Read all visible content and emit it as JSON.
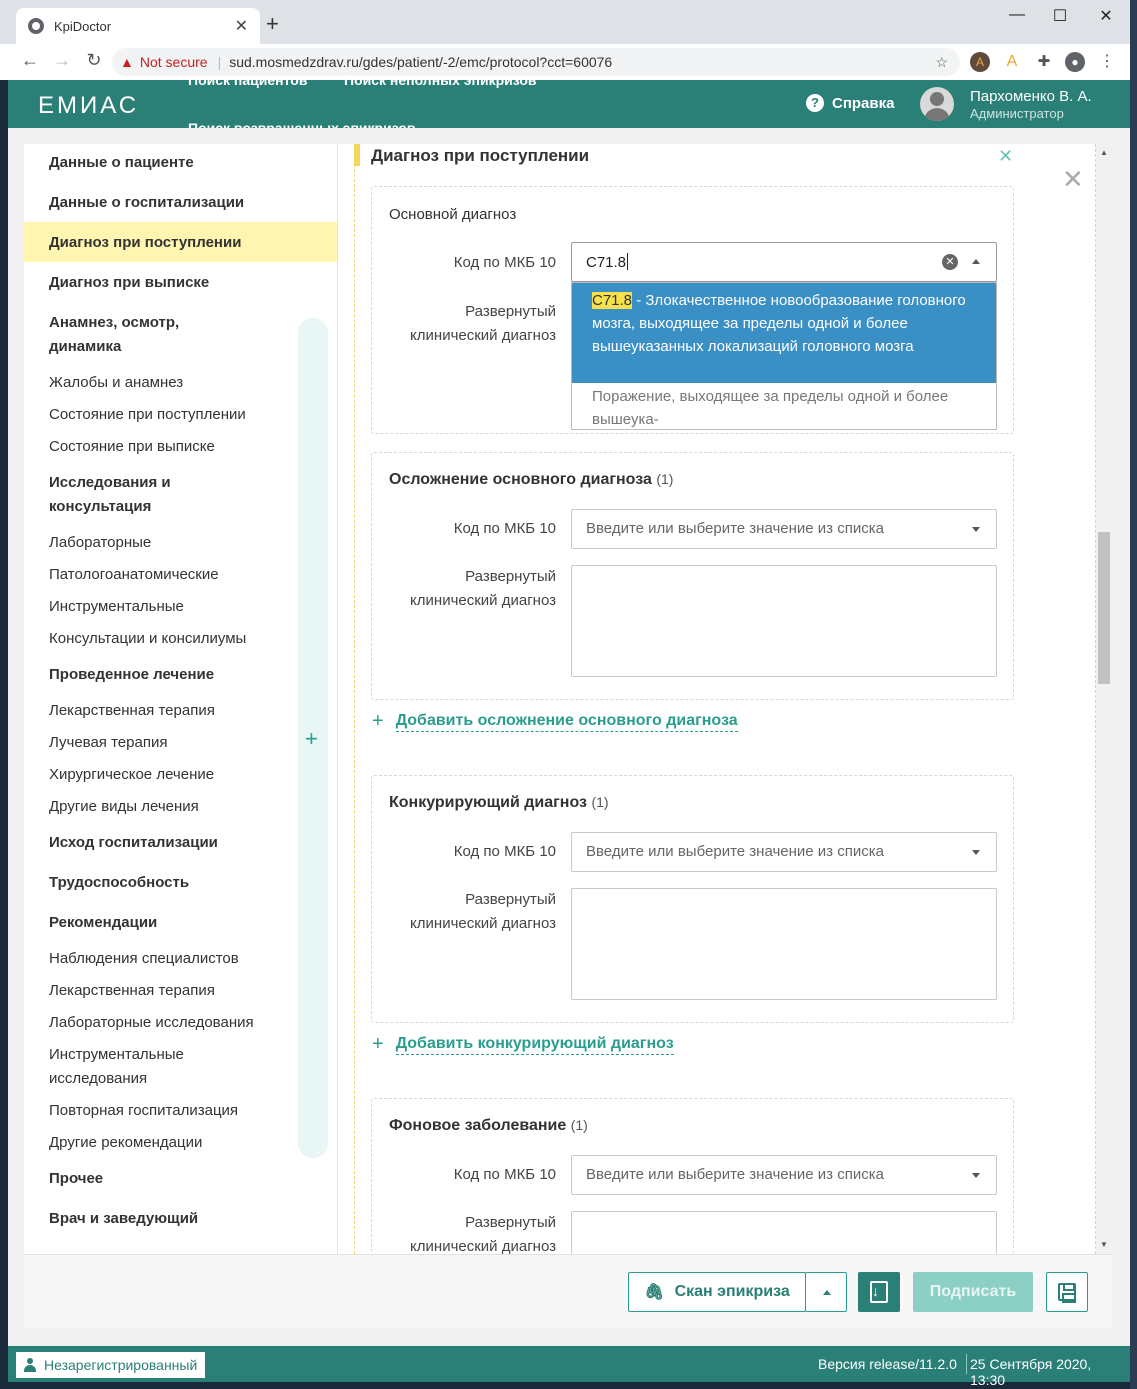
{
  "browser": {
    "tab_title": "KpiDoctor",
    "tab_close": "✕",
    "new_tab": "+",
    "window_min": "—",
    "window_max": "☐",
    "window_close": "✕",
    "not_secure": "Not secure",
    "url": "sud.mosmedzdrav.ru/gdes/patient/-2/emc/protocol?cct=60076"
  },
  "header": {
    "logo": "ЕМИАС",
    "nav": [
      "Поиск пациентов",
      "Поиск неполных эпикризов",
      "Поиск возвращенных эпикризов"
    ],
    "help": "Справка",
    "user_name": "Пархоменко В. А.",
    "user_role": "Администратор"
  },
  "sidebar": {
    "items": [
      {
        "label": "Данные о пациенте",
        "bold": true
      },
      {
        "label": "Данные о госпитализации",
        "bold": true
      },
      {
        "label": "Диагноз при поступлении",
        "bold": true,
        "active": true
      },
      {
        "label": "Диагноз при выписке",
        "bold": true
      },
      {
        "label": "Анамнез, осмотр, динамика",
        "bold": true
      },
      {
        "label": "Жалобы и анамнез",
        "bold": false
      },
      {
        "label": "Состояние при поступлении",
        "bold": false
      },
      {
        "label": "Состояние при выписке",
        "bold": false
      },
      {
        "label": "Исследования и консультация",
        "bold": true
      },
      {
        "label": "Лабораторные",
        "bold": false
      },
      {
        "label": "Патологоанатомические",
        "bold": false
      },
      {
        "label": "Инструментальные",
        "bold": false
      },
      {
        "label": "Консультации и консилиумы",
        "bold": false
      },
      {
        "label": "Проведенное лечение",
        "bold": true
      },
      {
        "label": "Лекарственная терапия",
        "bold": false
      },
      {
        "label": "Лучевая терапия",
        "bold": false
      },
      {
        "label": "Хирургическое лечение",
        "bold": false
      },
      {
        "label": "Другие виды лечения",
        "bold": false
      },
      {
        "label": "Исход госпитализации",
        "bold": true
      },
      {
        "label": "Трудоспособность",
        "bold": true
      },
      {
        "label": "Рекомендации",
        "bold": true
      },
      {
        "label": "Наблюдения специалистов",
        "bold": false
      },
      {
        "label": "Лекарственная терапия",
        "bold": false
      },
      {
        "label": "Лабораторные исследования",
        "bold": false
      },
      {
        "label": "Инструментальные исследования",
        "bold": false
      },
      {
        "label": "Повторная госпитализация",
        "bold": false
      },
      {
        "label": "Другие рекомендации",
        "bold": false
      },
      {
        "label": "Прочее",
        "bold": true
      },
      {
        "label": "Врач и заведующий",
        "bold": true
      }
    ],
    "add": "+"
  },
  "form": {
    "section_title": "Диагноз при поступлении",
    "labels": {
      "icd": "Код по МКБ 10",
      "clinical": "Развернутый клинический диагноз"
    },
    "placeholder": "Введите или выберите значение из списка",
    "main": {
      "title": "Основной диагноз",
      "icd_value": "C71.8"
    },
    "dropdown": {
      "opt1_code": "C71.8",
      "opt1_text": " - Злокачественное новообразование головного мозга, выходящее за пределы одной и более вышеуказанных локализаций головного мозга",
      "opt2_text": "Поражение, выходящее за пределы одной и более вышеука-"
    },
    "complication": {
      "title": "Осложнение основного диагноза",
      "count": "(1)",
      "add_label": "Добавить осложнение основного диагноза"
    },
    "competing": {
      "title": "Конкурирующий диагноз",
      "count": "(1)",
      "add_label": "Добавить конкурирующий диагноз"
    },
    "background": {
      "title": "Фоновое заболевание",
      "count": "(1)"
    }
  },
  "footer": {
    "scan_label": "Скан эпикриза",
    "sign_label": "Подписать"
  },
  "statusbar": {
    "user": "Незарегистрированный",
    "version": "Версия release/11.2.0",
    "datetime": "25 Сентября 2020, 13:30"
  },
  "colors": {
    "brand": "#2a7f76",
    "accent": "#2a9d8f",
    "active_nav": "#fdf5b0",
    "selected_option": "#3a8fc5",
    "match_highlight": "#f6e04b"
  }
}
